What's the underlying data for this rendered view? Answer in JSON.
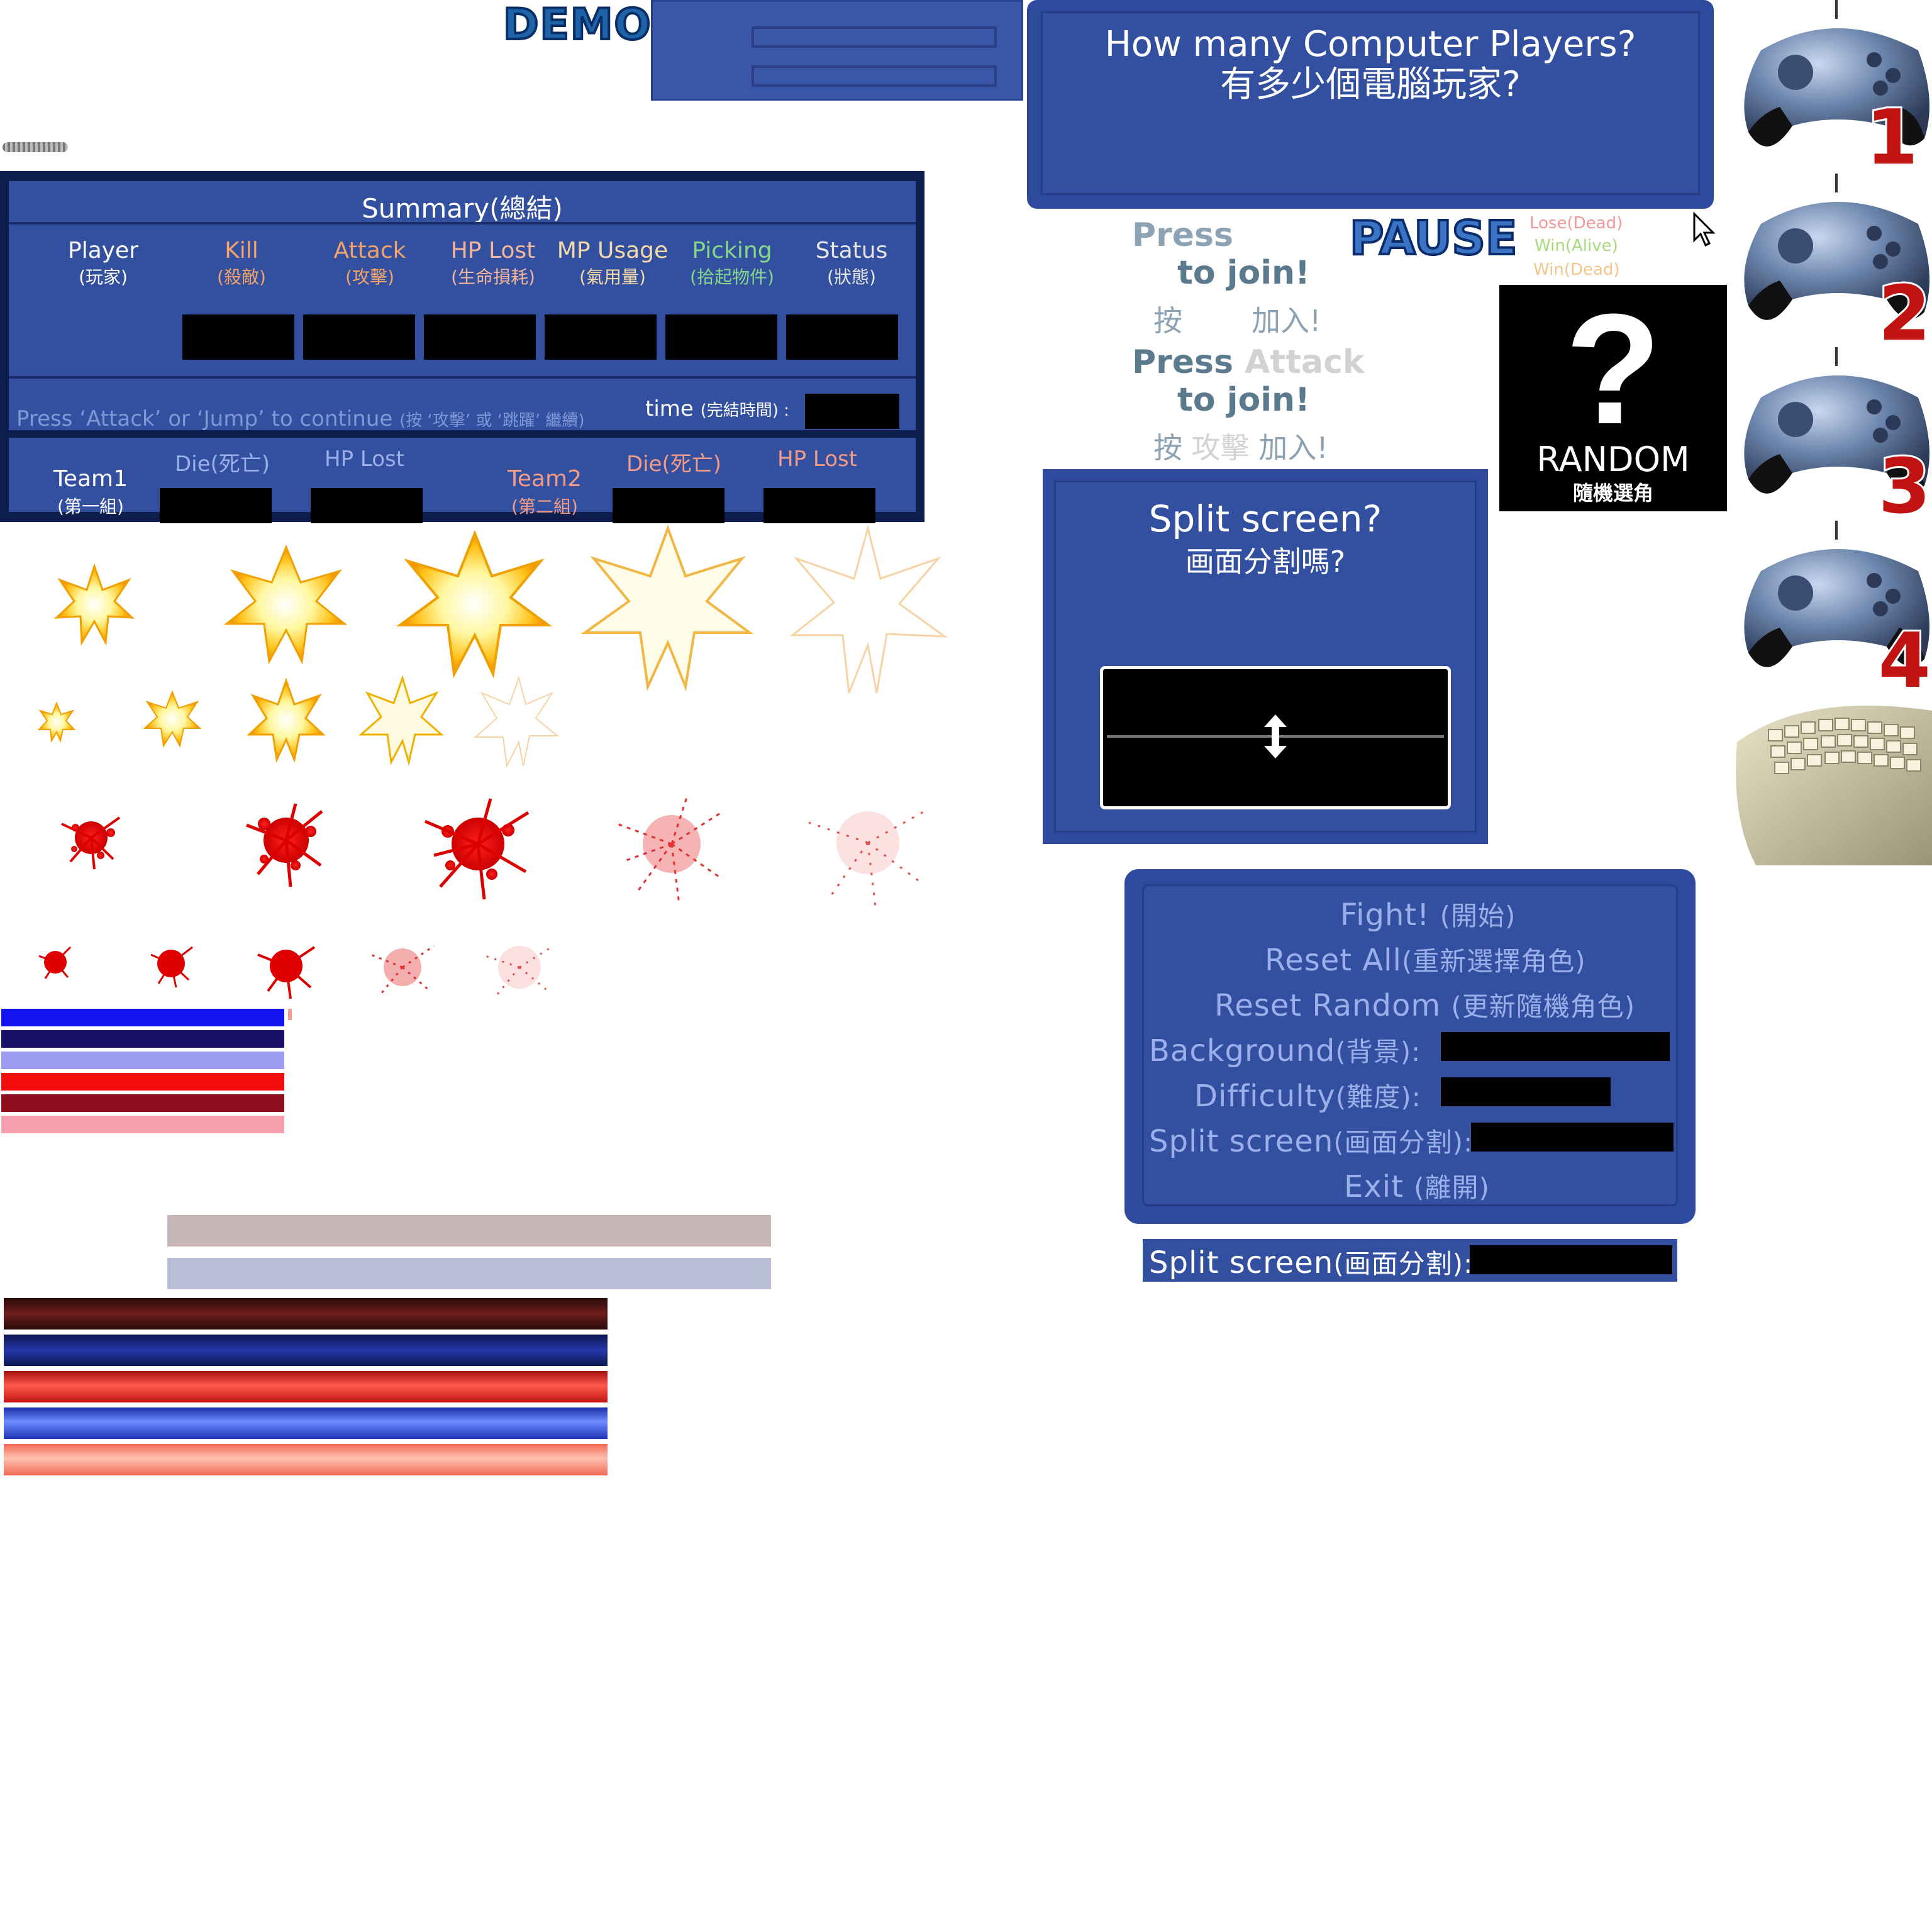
{
  "demo": {
    "label": "DEMO"
  },
  "summary": {
    "title": "Summary(總結)",
    "columns": [
      {
        "label": "Player",
        "sub": "(玩家)",
        "color": "#ffffff"
      },
      {
        "label": "Kill",
        "sub": "(殺敵)",
        "color": "#f1a36a"
      },
      {
        "label": "Attack",
        "sub": "(攻擊)",
        "color": "#f1a36a"
      },
      {
        "label": "HP Lost",
        "sub": "(生命損耗)",
        "color": "#f4b69a"
      },
      {
        "label": "MP Usage",
        "sub": "(氣用量)",
        "color": "#f4dba6"
      },
      {
        "label": "Picking",
        "sub": "(拾起物件)",
        "color": "#86d889"
      },
      {
        "label": "Status",
        "sub": "(狀態)",
        "color": "#e6e6e6"
      }
    ],
    "continue_text": "Press ‘Attack’ or ‘Jump’ to continue",
    "continue_sub": "(按 ‘攻擊’ 或 ‘跳躍’ 繼續)",
    "time_label": "time",
    "time_sub": "(完結時間) :",
    "team1": {
      "label": "Team1",
      "sub": "(第一組)",
      "die": "Die(死亡)",
      "hp": "HP Lost"
    },
    "team2": {
      "label": "Team2",
      "sub": "(第二組)",
      "die": "Die(死亡)",
      "hp": "HP Lost"
    }
  },
  "cpu_dialog": {
    "title": "How many Computer Players?",
    "title_zh": "有多少個電腦玩家?"
  },
  "join": {
    "press1": "Press",
    "tojoin1": "to join!",
    "zh1a": "按",
    "zh1b": "加入!",
    "press2": "Press",
    "attack": "Attack",
    "tojoin2": "to join!",
    "zh2a": "按",
    "zh2b": "攻擊",
    "zh2c": "加入!"
  },
  "pause": {
    "label": "PAUSE"
  },
  "status_legend": {
    "lose": "Lose(Dead)",
    "win_alive": "Win(Alive)",
    "win_dead": "Win(Dead)"
  },
  "random": {
    "q": "?",
    "label": "RANDOM",
    "label_zh": "隨機選角"
  },
  "split_dialog": {
    "title": "Split screen?",
    "title_zh": "画面分割嗎?"
  },
  "controllers": [
    {
      "number": "1"
    },
    {
      "number": "2"
    },
    {
      "number": "3"
    },
    {
      "number": "4"
    }
  ],
  "menu": {
    "fight": "Fight!",
    "fight_zh": "(開始)",
    "reset_all": "Reset All",
    "reset_all_zh": "(重新選擇角色)",
    "reset_random": "Reset Random",
    "reset_random_zh": "(更新隨機角色)",
    "background": "Background",
    "background_zh": "(背景):",
    "difficulty": "Difficulty",
    "difficulty_zh": "(難度):",
    "split": "Split screen",
    "split_zh": "(画面分割):",
    "exit": "Exit",
    "exit_zh": "(離開)"
  },
  "split_strip": {
    "label": "Split screen",
    "label_zh": "(画面分割):"
  },
  "colors": {
    "panel": "#3350a0",
    "panel_dark": "#0d1d4e",
    "accent_red": "#e00000",
    "accent_blue": "#1515e8"
  }
}
